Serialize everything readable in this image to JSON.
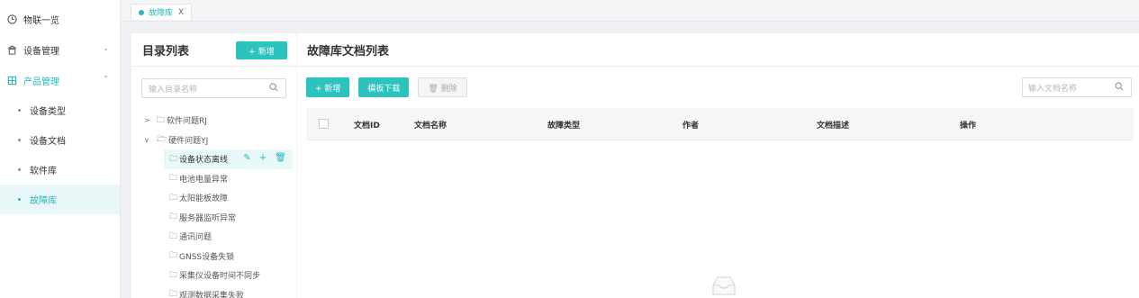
{
  "nav": {
    "items": [
      {
        "label": "物联一览",
        "icon": "clock-icon"
      },
      {
        "label": "设备管理",
        "icon": "device-icon",
        "chevron": "down"
      },
      {
        "label": "产品管理",
        "icon": "product-icon",
        "chevron": "up"
      }
    ],
    "sub": [
      "设备类型",
      "设备文档",
      "软件库",
      "故障库"
    ]
  },
  "tabs": [
    {
      "label": "故障库",
      "close": "X"
    }
  ],
  "dir": {
    "title": "目录列表",
    "add_label": "+ 新增",
    "search_placeholder": "输入目录名称",
    "tree": [
      {
        "label": "软件问题RJ",
        "caret": ">"
      },
      {
        "label": "硬件问题YJ",
        "caret": "∨"
      }
    ],
    "children": [
      "设备状态离线",
      "电池电量异常",
      "太阳能板故障",
      "服务器监听异常",
      "通讯问题",
      "GNSS设备失锁",
      "采集仪设备时间不同步",
      "观测数据采集失败"
    ],
    "selected_actions": "✎ + 🗑"
  },
  "main": {
    "title": "故障库文档列表",
    "buttons": {
      "add": "+ 新增",
      "template": "模板下载",
      "delete": "🗑 删除"
    },
    "search_placeholder": "输入文档名称",
    "columns": [
      "文档ID",
      "文档名称",
      "故障类型",
      "作者",
      "文档描述",
      "操作"
    ]
  },
  "colors": {
    "accent": "#2cc3bf"
  }
}
